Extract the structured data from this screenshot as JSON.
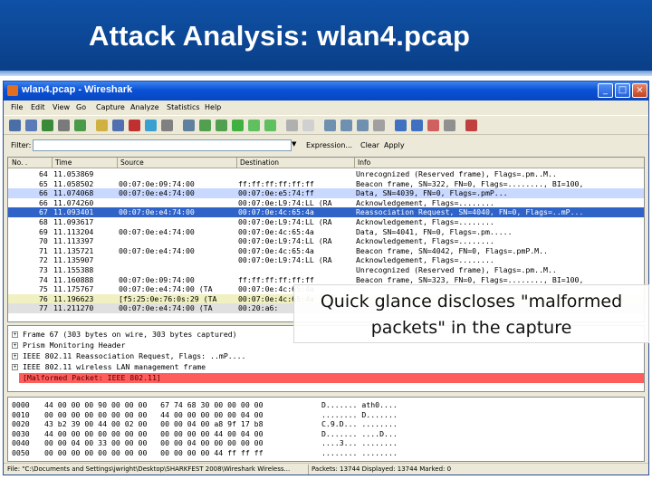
{
  "slide": {
    "title": "Attack Analysis: wlan4.pcap"
  },
  "window": {
    "title": "wlan4.pcap - Wireshark",
    "controls": {
      "minimize": "_",
      "maximize": "□",
      "close": "×"
    }
  },
  "menu": [
    "File",
    "Edit",
    "View",
    "Go",
    "Capture",
    "Analyze",
    "Statistics",
    "Help"
  ],
  "filter": {
    "label": "Filter:",
    "value": "",
    "expression": "Expression...",
    "clear": "Clear",
    "apply": "Apply"
  },
  "packet_list": {
    "columns": [
      "No. .",
      "Time",
      "Source",
      "Destination",
      "Info"
    ],
    "rows": [
      {
        "no": "64",
        "time": "11.053869",
        "src": "",
        "dst": "",
        "info": "Unrecognized (Reserved frame), Flags=.pm..M..",
        "color": "#ffffff"
      },
      {
        "no": "65",
        "time": "11.058502",
        "src": "00:07:0e:09:74:00",
        "dst": "ff:ff:ff:ff:ff:ff",
        "info": "Beacon frame, SN=322, FN=0, Flags=........, BI=100,",
        "color": "#ffffff"
      },
      {
        "no": "66",
        "time": "11.074068",
        "src": "00:07:0e:e4:74:00",
        "dst": "00:07:0e:e5:74:ff",
        "info": "Data, SN=4039, FN=0, Flags=.pmP...",
        "color": "#c8d8ff"
      },
      {
        "no": "66",
        "time": "11.074260",
        "src": "",
        "dst": "00:07:0e:L9:74:LL (RA",
        "info": "Acknowledgement, Flags=........",
        "color": "#ffffff"
      },
      {
        "no": "67",
        "time": "11.093401",
        "src": "00:07:0e:e4:74:00",
        "dst": "00:07:0e:4c:65:4a",
        "info": "Reassociation Request, SN=4040, FN=0, Flags=..mP...",
        "color": "#2f63c8",
        "selected": true
      },
      {
        "no": "68",
        "time": "11.093617",
        "src": "",
        "dst": "00:07:0e:L9:74:LL (RA",
        "info": "Acknowledgement, Flags=........",
        "color": "#ffffff"
      },
      {
        "no": "69",
        "time": "11.113204",
        "src": "00:07:0e:e4:74:00",
        "dst": "00:07:0e:4c:65:4a",
        "info": "Data, SN=4041, FN=0, Flags=.pm.....",
        "color": "#ffffff"
      },
      {
        "no": "70",
        "time": "11.113397",
        "src": "",
        "dst": "00:07:0e:L9:74:LL (RA",
        "info": "Acknowledgement, Flags=........",
        "color": "#ffffff"
      },
      {
        "no": "71",
        "time": "11.135721",
        "src": "00:07:0e:e4:74:00",
        "dst": "00:07:0e:4c:65:4a",
        "info": "Beacon frame, SN=4042, FN=0, Flags=.pmP.M..",
        "color": "#ffffff"
      },
      {
        "no": "72",
        "time": "11.135907",
        "src": "",
        "dst": "00:07:0e:L9:74:LL (RA",
        "info": "Acknowledgement, Flags=........",
        "color": "#ffffff"
      },
      {
        "no": "73",
        "time": "11.155388",
        "src": "",
        "dst": "",
        "info": "Unrecognized (Reserved frame), Flags=.pm..M..",
        "color": "#ffffff"
      },
      {
        "no": "74",
        "time": "11.160888",
        "src": "00:07:0e:09:74:00",
        "dst": "ff:ff:ff:ff:ff:ff",
        "info": "Beacon frame, SN=323, FN=0, Flags=........, BI=100,",
        "color": "#ffffff"
      },
      {
        "no": "75",
        "time": "11.175767",
        "src": "00:07:0e:e4:74:00 (TA",
        "dst": "00:07:0e:4c:65:4a",
        "info": "",
        "color": "#ffffff"
      },
      {
        "no": "76",
        "time": "11.196623",
        "src": "[f5:25:0e:76:0s:29 (TA",
        "dst": "00:07:0e:4c:65:4a",
        "info": "",
        "color": "#f0f0c0"
      },
      {
        "no": "77",
        "time": "11.211270",
        "src": "00:07:0e:e4:74:00 (TA",
        "dst": "00:20:a6:",
        "info": "",
        "color": "#e0e0e0"
      }
    ]
  },
  "details": [
    {
      "text": "Frame 67 (303 bytes on wire, 303 bytes captured)",
      "expander": "+"
    },
    {
      "text": "Prism Monitoring Header",
      "expander": "+"
    },
    {
      "text": "IEEE 802.11 Reassociation Request, Flags: ..mP....",
      "expander": "+"
    },
    {
      "text": "IEEE 802.11 wireless LAN management frame",
      "expander": "+"
    },
    {
      "text": "[Malformed Packet: IEEE 802.11]",
      "expander": "",
      "malformed": true
    }
  ],
  "bytes": [
    {
      "off": "0000",
      "hex": "44 00 00 00 90 00 00 00   67 74 68 30 00 00 00 00",
      "ascii": "D....... ath0...."
    },
    {
      "off": "0010",
      "hex": "00 00 00 00 00 00 00 00   44 00 00 00 00 00 04 00",
      "ascii": "........ D......."
    },
    {
      "off": "0020",
      "hex": "43 b2 39 00 44 00 02 00   00 00 04 00 a8 9f 17 b8",
      "ascii": "C.9.D... ........"
    },
    {
      "off": "0030",
      "hex": "44 00 00 00 00 00 00 00   00 00 00 00 44 00 04 00",
      "ascii": "D....... ....D..."
    },
    {
      "off": "0040",
      "hex": "00 00 04 00 33 00 00 00   00 00 04 00 00 00 00 00",
      "ascii": "....3... ........"
    },
    {
      "off": "0050",
      "hex": "00 00 00 00 00 00 00 00   00 00 00 00 44 ff ff ff",
      "ascii": "........ ........"
    }
  ],
  "status": {
    "file": "File: \"C:\\Documents and Settings\\jwright\\Desktop\\SHARKFEST 2008\\Wireshark Wireless...",
    "packets": "Packets: 13744 Displayed: 13744 Marked: 0"
  },
  "callout": {
    "line1": "Quick glance discloses \"malformed",
    "line2": "packets\" in the capture"
  },
  "colors": {
    "slide_header": "#0f51a6",
    "selected_row": "#2f63c8",
    "malformed_row": "#ff5c5c"
  }
}
